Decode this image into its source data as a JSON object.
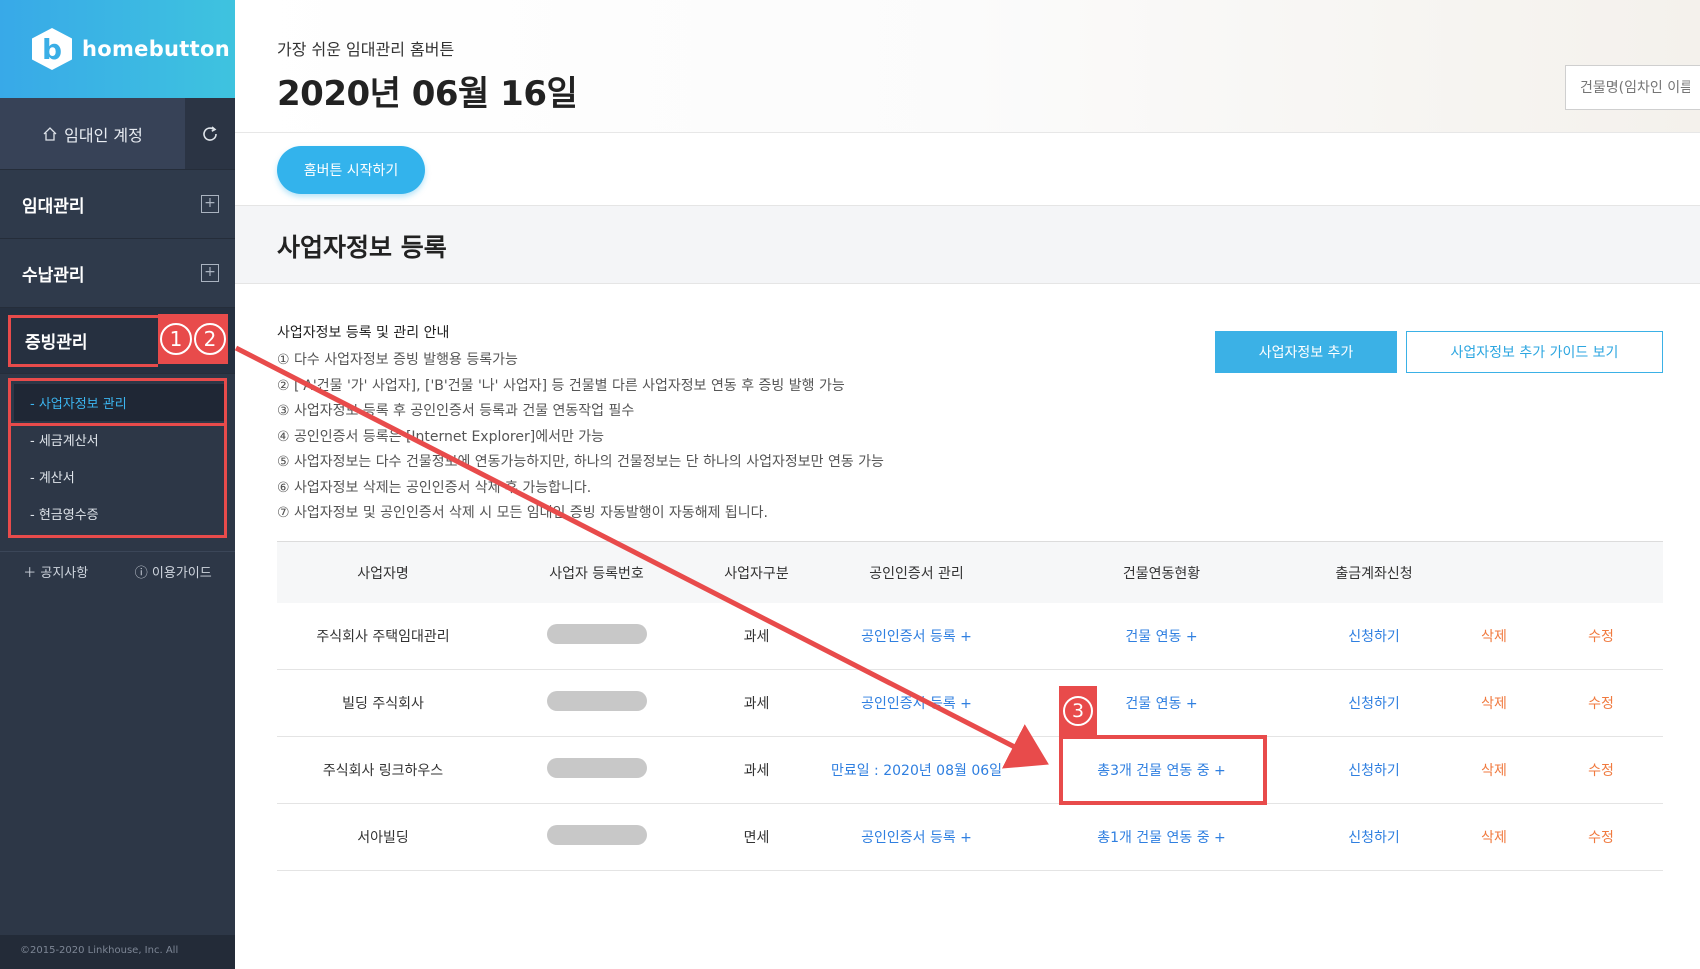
{
  "brand": {
    "name": "homebutton",
    "logo_letter": "b"
  },
  "sidebar": {
    "account_label": "임대인 계정",
    "menu": [
      {
        "label": "임대관리"
      },
      {
        "label": "수납관리"
      },
      {
        "label": "증빙관리"
      }
    ],
    "submenu": [
      {
        "label": "- 사업자정보 관리"
      },
      {
        "label": "- 세금계산서"
      },
      {
        "label": "- 계산서"
      },
      {
        "label": "- 현금영수증"
      }
    ],
    "notice_label": "공지사항",
    "guide_label": "이용가이드",
    "copyright": "©2015-2020 Linkhouse, Inc. All"
  },
  "header": {
    "tagline": "가장 쉬운 임대관리 홈버튼",
    "date": "2020년 06월 16일",
    "search_placeholder": "건물명(임차인 이름)"
  },
  "start_button": "홈버튼 시작하기",
  "page_title": "사업자정보 등록",
  "guide": {
    "title": "사업자정보 등록 및 관리 안내",
    "lines": [
      "① 다수 사업자정보 증빙 발행용 등록가능",
      "② ['A'건물 '가' 사업자], ['B'건물 '나' 사업자] 등 건물별 다른 사업자정보 연동 후 증빙 발행 가능",
      "③ 사업자정보 등록 후 공인인증서 등록과 건물 연동작업 필수",
      "④ 공인인증서 등록은 [Internet Explorer]에서만 가능",
      "⑤ 사업자정보는 다수 건물정보에 연동가능하지만, 하나의 건물정보는 단 하나의 사업자정보만 연동 가능",
      "⑥ 사업자정보 삭제는 공인인증서 삭제 후 가능합니다.",
      "⑦ 사업자정보 및 공인인증서 삭제 시 모든 임대인 증빙 자동발행이 자동해제 됩니다."
    ]
  },
  "buttons": {
    "add": "사업자정보 추가",
    "add_guide": "사업자정보 추가 가이드 보기"
  },
  "table": {
    "headers": [
      "사업자명",
      "사업자 등록번호",
      "사업자구분",
      "공인인증서 관리",
      "건물연동현황",
      "출금계좌신청",
      "",
      ""
    ],
    "rows": [
      {
        "name": "주식회사 주택임대관리",
        "type": "과세",
        "cert": "공인인증서 등록 +",
        "building": "건물 연동 +",
        "account": "신청하기",
        "delete": "삭제",
        "edit": "수정"
      },
      {
        "name": "빌딩 주식회사",
        "type": "과세",
        "cert": "공인인증서 등록 +",
        "building": "건물 연동 +",
        "account": "신청하기",
        "delete": "삭제",
        "edit": "수정"
      },
      {
        "name": "주식회사 링크하우스",
        "type": "과세",
        "cert": "만료일 : 2020년 08월 06일",
        "building": "총3개 건물 연동 중 +",
        "account": "신청하기",
        "delete": "삭제",
        "edit": "수정"
      },
      {
        "name": "서아빌딩",
        "type": "면세",
        "cert": "공인인증서 등록 +",
        "building": "총1개 건물 연동 중 +",
        "account": "신청하기",
        "delete": "삭제",
        "edit": "수정"
      }
    ]
  },
  "annotations": {
    "badge_1": "1",
    "badge_2": "2",
    "badge_3": "3",
    "color": "#e84b4b"
  }
}
